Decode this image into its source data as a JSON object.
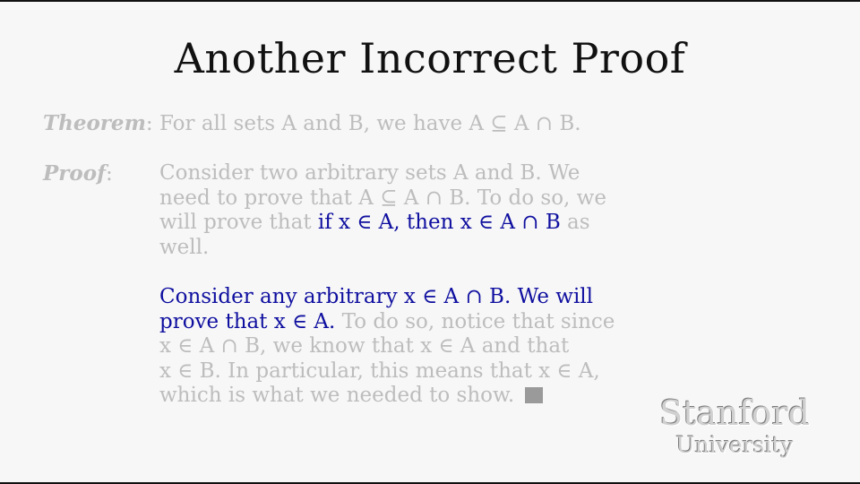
{
  "slide": {
    "title": "Another Incorrect Proof",
    "theorem": {
      "label": "Theorem",
      "colon": ":",
      "text": " For all sets A and B, we have A ⊆ A ∩ B."
    },
    "proof": {
      "label": "Proof",
      "colon": ":",
      "para1": {
        "line1": "Consider two arbitrary sets A and B. We",
        "line2": "need to prove that A ⊆ A ∩ B. To do so, we",
        "line3_pre": "will prove that ",
        "line3_hl": "if x ∈ A, then x ∈ A ∩ B",
        "line3_post": " as",
        "line4": "well."
      },
      "para2": {
        "line1_hl": "Consider any arbitrary x ∈ A ∩ B. We will",
        "line2_hl": "prove that x ∈ A.",
        "line2_post": " To do so, notice that since",
        "line3": "x ∈ A ∩ B, we know that x ∈ A and that",
        "line4": "x ∈ B. In particular, this means that x ∈ A,",
        "line5": "which is what we needed to show. "
      }
    }
  },
  "logo": {
    "name": "Stanford",
    "subtitle": "University"
  },
  "colors": {
    "background": "#f7f7f7",
    "title": "#111111",
    "faded_text": "#bdbdbd",
    "highlight": "#0f0fa0"
  }
}
